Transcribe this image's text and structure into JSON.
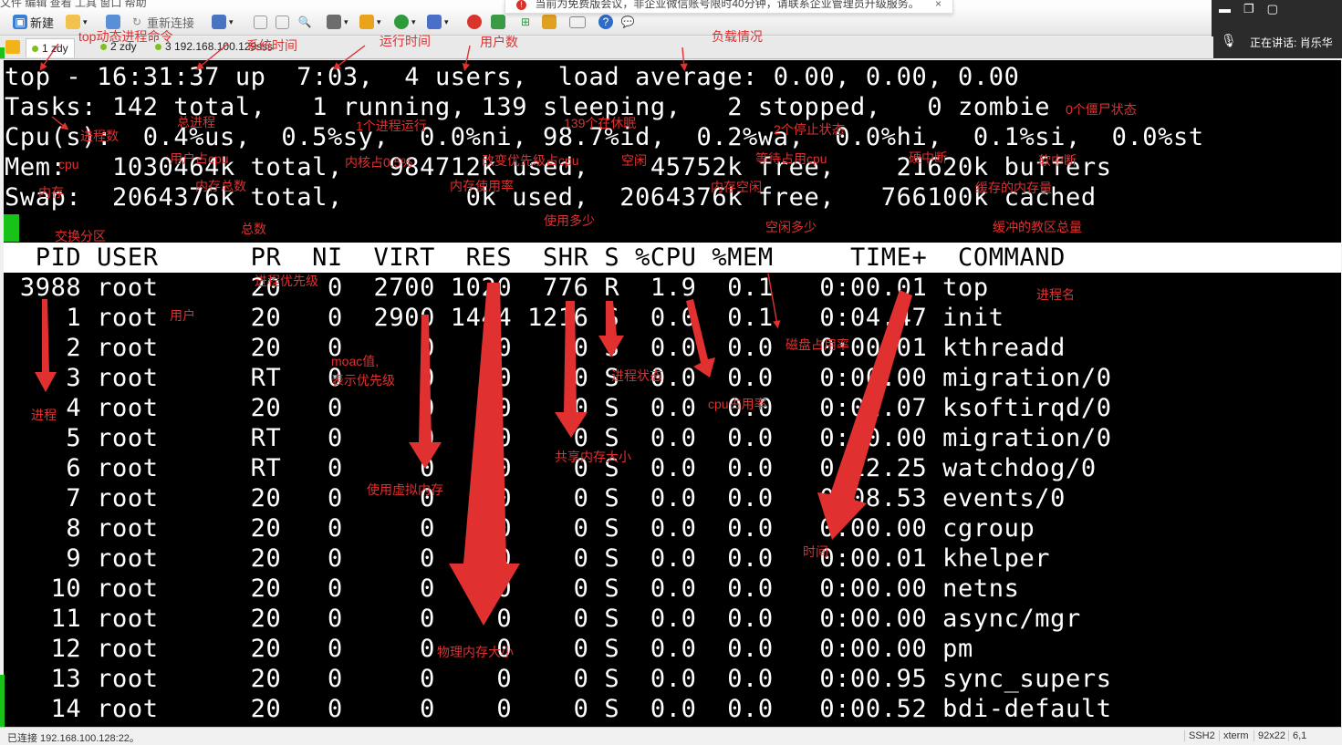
{
  "menu_strip": "文件  编辑  查看  工具  窗口  帮助",
  "notification": {
    "text": "当前为免费版会议，非企业微信账号限时40分钟，请联系企业管理员升级服务。",
    "close": "×"
  },
  "side_panel": {
    "speaking_label": "正在讲话:",
    "speaker": "肖乐华"
  },
  "toolbar": {
    "new_label": "新建",
    "reconnect_label": "重新连接"
  },
  "tabs": [
    {
      "label": "1 zdy"
    },
    {
      "label": "2 zdy"
    },
    {
      "label": "3 192.168.100.129sss"
    }
  ],
  "terminal": {
    "lines": [
      "top - 16:31:37 up  7:03,  4 users,  load average: 0.00, 0.00, 0.00",
      "Tasks: 142 total,   1 running, 139 sleeping,   2 stopped,   0 zombie",
      "Cpu(s):  0.4%us,  0.5%sy,  0.0%ni, 98.7%id,  0.2%wa,  0.0%hi,  0.1%si,  0.0%st",
      "Mem:   1030464k total,   984712k used,    45752k free,    21620k buffers",
      "Swap:  2064376k total,        0k used,  2064376k free,   766100k cached"
    ],
    "header": "  PID USER      PR  NI  VIRT  RES  SHR S %CPU %MEM     TIME+  COMMAND",
    "rows": [
      " 3988 root      20   0  2700 1020  776 R  1.9  0.1   0:00.01 top",
      "    1 root      20   0  2900 1444 1216 S  0.0  0.1   0:04.47 init",
      "    2 root      20   0     0    0    0 S  0.0  0.0   0:00.01 kthreadd",
      "    3 root      RT   0     0    0    0 S  0.0  0.0   0:00.00 migration/0",
      "    4 root      20   0     0    0    0 S  0.0  0.0   0:02.07 ksoftirqd/0",
      "    5 root      RT   0     0    0    0 S  0.0  0.0   0:00.00 migration/0",
      "    6 root      RT   0     0    0    0 S  0.0  0.0   0:12.25 watchdog/0",
      "    7 root      20   0     0    0    0 S  0.0  0.0   0:08.53 events/0",
      "    8 root      20   0     0    0    0 S  0.0  0.0   0:00.00 cgroup",
      "    9 root      20   0     0    0    0 S  0.0  0.0   0:00.01 khelper",
      "   10 root      20   0     0    0    0 S  0.0  0.0   0:00.00 netns",
      "   11 root      20   0     0    0    0 S  0.0  0.0   0:00.00 async/mgr",
      "   12 root      20   0     0    0    0 S  0.0  0.0   0:00.00 pm",
      "   13 root      20   0     0    0    0 S  0.0  0.0   0:00.95 sync_supers",
      "   14 root      20   0     0    0    0 S  0.0  0.0   0:00.52 bdi-default"
    ]
  },
  "annotations": {
    "top_cmd": "top动态进程命令",
    "sys_time": "系统时间",
    "run_time": "运行时间",
    "users": "用户数",
    "load": "负载情况",
    "zombie": "0个僵尸状态",
    "proc_count": "进程数",
    "total_proc": "总进程",
    "one_running": "1个进程运行",
    "sleeping": "139个在休眠",
    "stopped": "2个停止状态",
    "cpu": "cpu",
    "user_cpu": "用户占cpu",
    "kernel": "内核占0.5%",
    "nice_cpu": "改变优先级占cpu",
    "idle": "空闲",
    "wait_cpu": "等待占用cpu",
    "hard_irq": "硬中断",
    "soft_irq": "软中断",
    "mem": "内存",
    "mem_total": "内存总数",
    "mem_usage": "内存使用率",
    "mem_free": "内存空闲",
    "buffers": "缓存的内存量",
    "swap": "交换分区",
    "total": "总数",
    "used": "使用多少",
    "free_amt": "空闲多少",
    "cached": "缓冲的教区总量",
    "priority": "进程优先级",
    "user": "用户",
    "proc_name": "进程名",
    "nice_val": "moac值,",
    "nice_desc": "表示优先级",
    "disk": "磁盘占用率",
    "proc_state": "进程状态",
    "cpu_usage": "cpu占用率",
    "process": "进程",
    "shared": "共享内存大小",
    "virt": "使用虚拟内存",
    "time": "时间",
    "physical": "物理内存大小"
  },
  "status_bar": {
    "connection": "已连接 192.168.100.128:22。",
    "protocol": "SSH2",
    "term": "xterm",
    "size": "92x22",
    "pos": "6,1"
  }
}
